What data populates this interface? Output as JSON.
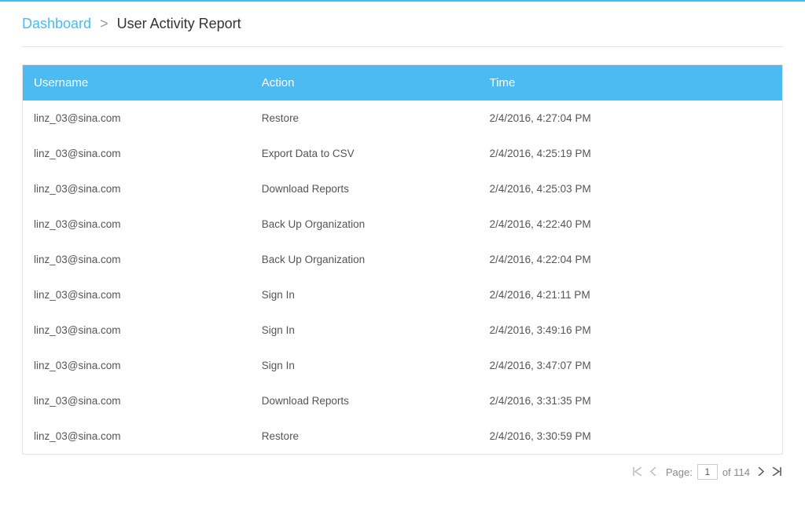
{
  "colors": {
    "accent": "#4bbbf2"
  },
  "breadcrumb": {
    "dashboard_label": "Dashboard",
    "separator": ">",
    "current_label": "User Activity Report"
  },
  "table": {
    "headers": {
      "username": "Username",
      "action": "Action",
      "time": "Time"
    },
    "rows": [
      {
        "username": "linz_03@sina.com",
        "action": "Restore",
        "time": "2/4/2016, 4:27:04 PM"
      },
      {
        "username": "linz_03@sina.com",
        "action": "Export Data to CSV",
        "time": "2/4/2016, 4:25:19 PM"
      },
      {
        "username": "linz_03@sina.com",
        "action": "Download Reports",
        "time": "2/4/2016, 4:25:03 PM"
      },
      {
        "username": "linz_03@sina.com",
        "action": "Back Up Organization",
        "time": "2/4/2016, 4:22:40 PM"
      },
      {
        "username": "linz_03@sina.com",
        "action": "Back Up Organization",
        "time": "2/4/2016, 4:22:04 PM"
      },
      {
        "username": "linz_03@sina.com",
        "action": "Sign In",
        "time": "2/4/2016, 4:21:11 PM"
      },
      {
        "username": "linz_03@sina.com",
        "action": "Sign In",
        "time": "2/4/2016, 3:49:16 PM"
      },
      {
        "username": "linz_03@sina.com",
        "action": "Sign In",
        "time": "2/4/2016, 3:47:07 PM"
      },
      {
        "username": "linz_03@sina.com",
        "action": "Download Reports",
        "time": "2/4/2016, 3:31:35 PM"
      },
      {
        "username": "linz_03@sina.com",
        "action": "Restore",
        "time": "2/4/2016, 3:30:59 PM"
      }
    ]
  },
  "pager": {
    "first_icon": "K",
    "prev_icon": "<",
    "page_label": "Page:",
    "current_page": "1",
    "of_label": "of 114",
    "next_icon": ">",
    "last_icon": ">I"
  }
}
